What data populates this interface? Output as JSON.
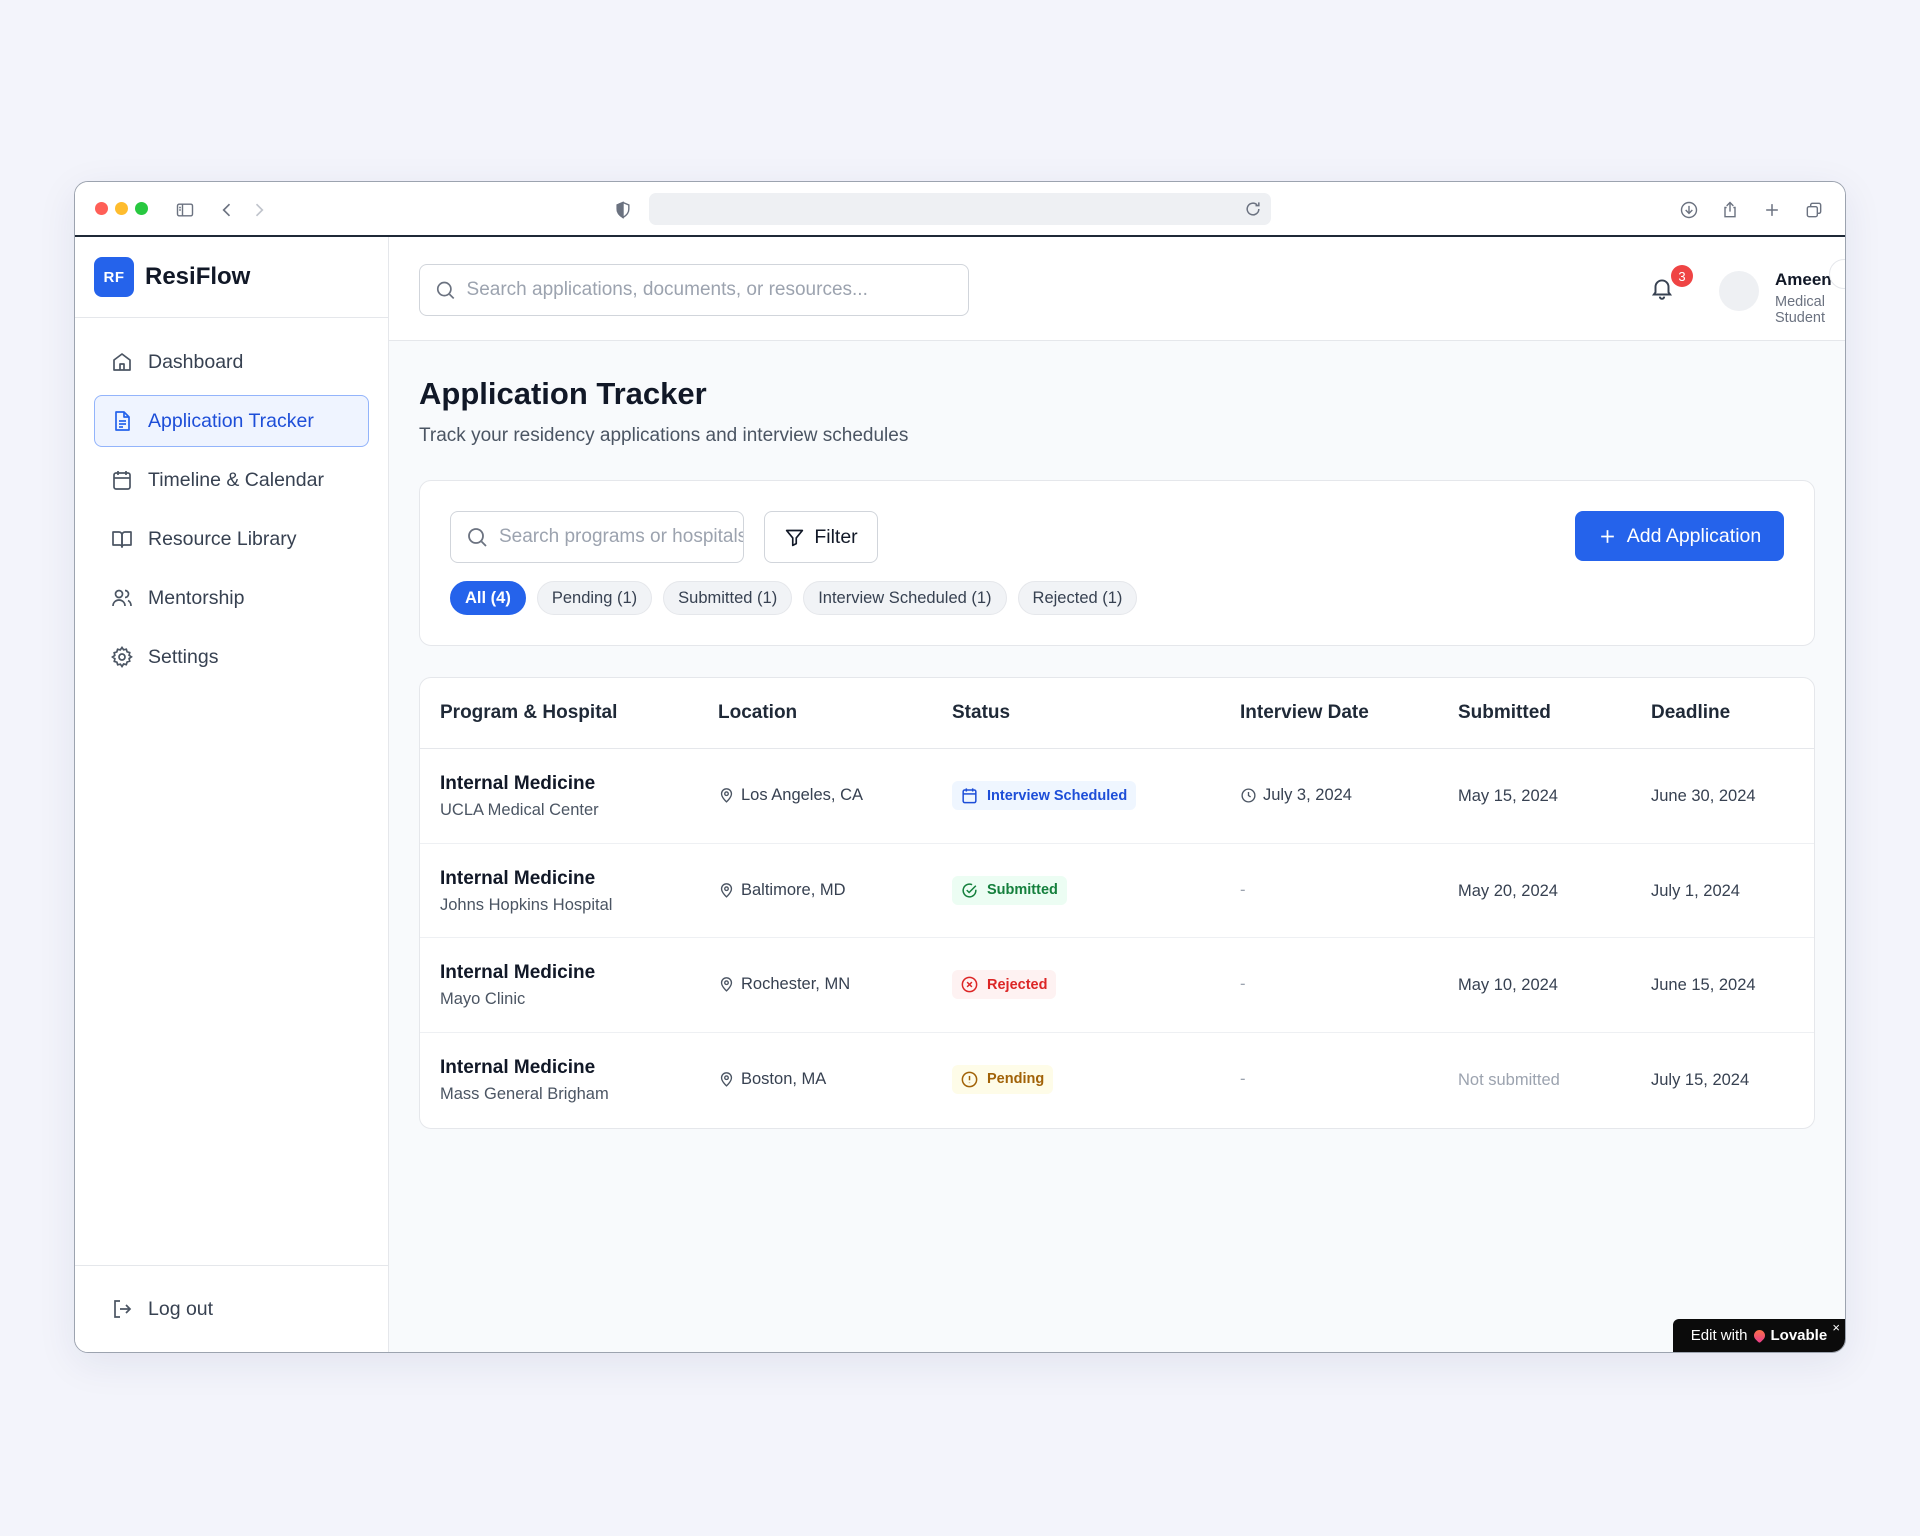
{
  "colors": {
    "accent": "#2563eb",
    "interview_bg": "#eff6ff",
    "interview_fg": "#1d4ed8",
    "submitted_bg": "#ecfdf3",
    "submitted_fg": "#15803d",
    "rejected_bg": "#fef2f2",
    "rejected_fg": "#dc2626",
    "pending_bg": "#fefce8",
    "pending_fg": "#a16207"
  },
  "brand": {
    "logo": "RF",
    "name": "ResiFlow"
  },
  "sidebar": {
    "items": [
      {
        "label": "Dashboard",
        "icon": "home-icon"
      },
      {
        "label": "Application Tracker",
        "icon": "document-icon",
        "active": true
      },
      {
        "label": "Timeline & Calendar",
        "icon": "calendar-icon"
      },
      {
        "label": "Resource Library",
        "icon": "book-icon"
      },
      {
        "label": "Mentorship",
        "icon": "users-icon"
      },
      {
        "label": "Settings",
        "icon": "gear-icon"
      }
    ],
    "logout": "Log out"
  },
  "topbar": {
    "search_placeholder": "Search applications, documents, or resources...",
    "notification_count": "3",
    "user_name": "Ameen",
    "user_role": "Medical Student"
  },
  "page": {
    "title": "Application Tracker",
    "subtitle": "Track your residency applications and interview schedules"
  },
  "filters": {
    "search_placeholder": "Search programs or hospitals...",
    "filter_label": "Filter",
    "add_label": "Add Application",
    "chips": [
      "All (4)",
      "Pending (1)",
      "Submitted (1)",
      "Interview Scheduled (1)",
      "Rejected (1)"
    ]
  },
  "table": {
    "headers": [
      "Program & Hospital",
      "Location",
      "Status",
      "Interview Date",
      "Submitted",
      "Deadline"
    ],
    "rows": [
      {
        "program": "Internal Medicine",
        "hospital": "UCLA Medical Center",
        "location": "Los Angeles, CA",
        "status": "Interview Scheduled",
        "status_icon": "calendar-icon",
        "interview_date": "July 3, 2024",
        "submitted": "May 15, 2024",
        "deadline": "June 30, 2024"
      },
      {
        "program": "Internal Medicine",
        "hospital": "Johns Hopkins Hospital",
        "location": "Baltimore, MD",
        "status": "Submitted",
        "status_icon": "check-circle-icon",
        "interview_date": "-",
        "submitted": "May 20, 2024",
        "deadline": "July 1, 2024"
      },
      {
        "program": "Internal Medicine",
        "hospital": "Mayo Clinic",
        "location": "Rochester, MN",
        "status": "Rejected",
        "status_icon": "x-circle-icon",
        "interview_date": "-",
        "submitted": "May 10, 2024",
        "deadline": "June 15, 2024"
      },
      {
        "program": "Internal Medicine",
        "hospital": "Mass General Brigham",
        "location": "Boston, MA",
        "status": "Pending",
        "status_icon": "alert-circle-icon",
        "interview_date": "-",
        "submitted": "Not submitted",
        "deadline": "July 15, 2024"
      }
    ]
  },
  "badge": {
    "prefix": "Edit with",
    "name": "Lovable",
    "close": "×"
  }
}
